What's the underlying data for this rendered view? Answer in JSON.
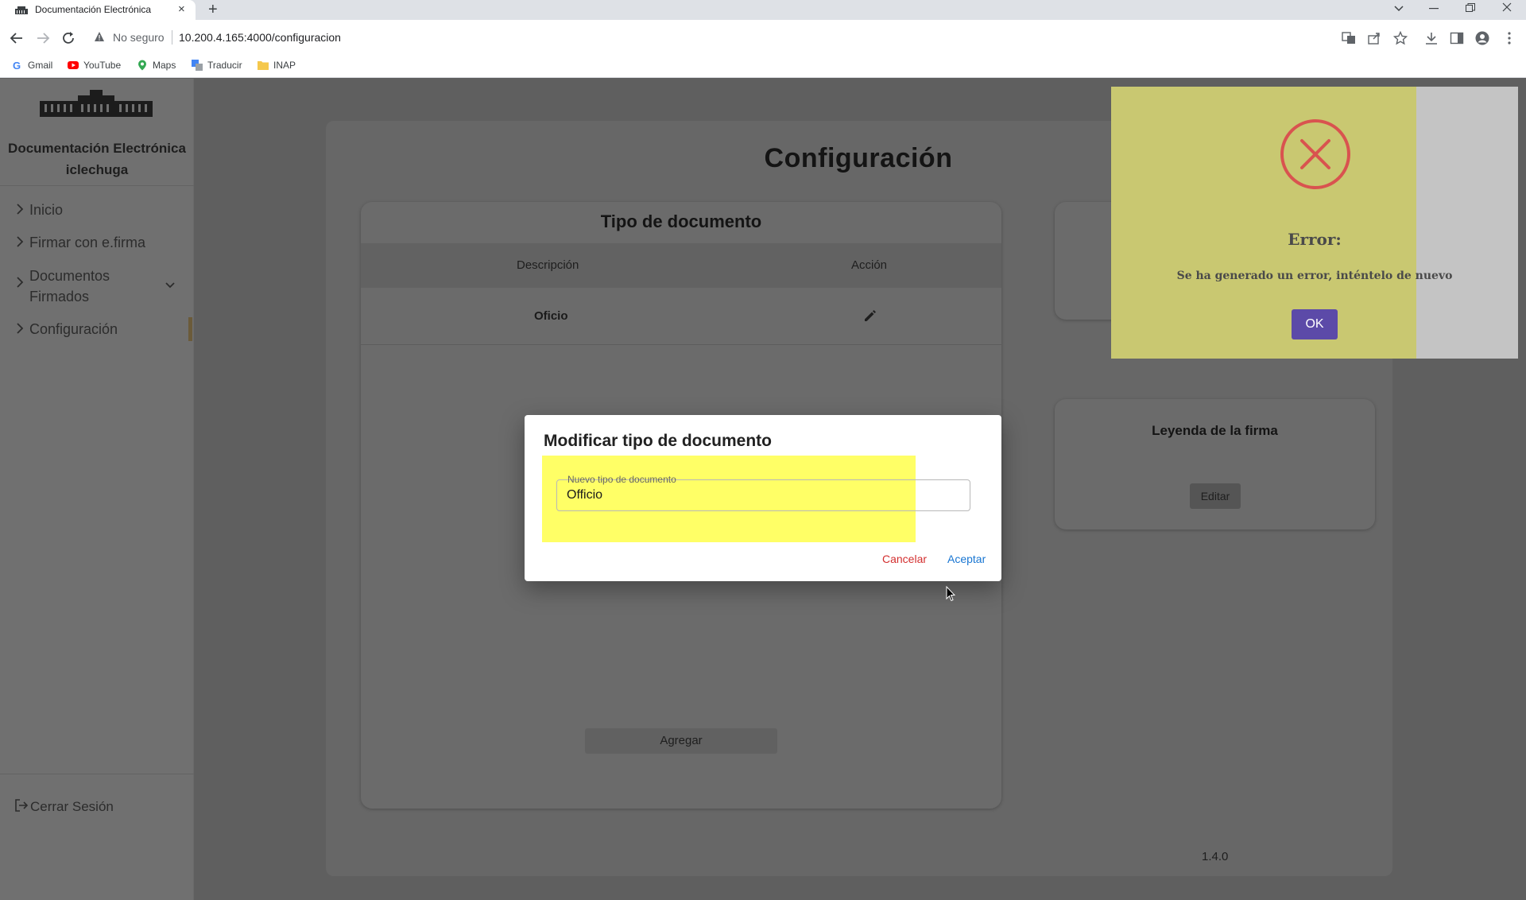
{
  "browser": {
    "tab_title": "Documentación Electrónica",
    "tab_close": "×",
    "new_tab": "+",
    "not_secure": "No seguro",
    "url": "10.200.4.165:4000/configuracion",
    "bookmarks": [
      "Gmail",
      "YouTube",
      "Maps",
      "Traducir",
      "INAP"
    ]
  },
  "sidebar": {
    "app_name": "Documentación Electrónica",
    "user": "iclechuga",
    "items": [
      {
        "label": "Inicio"
      },
      {
        "label": "Firmar con e.firma"
      },
      {
        "label": "Documentos Firmados"
      },
      {
        "label": "Configuración"
      }
    ],
    "logout": "Cerrar Sesión"
  },
  "main": {
    "title": "Configuración",
    "doc_card": {
      "title": "Tipo de documento",
      "columns": [
        "Descripción",
        "Acción"
      ],
      "rows": [
        {
          "descripcion": "Oficio"
        }
      ],
      "add_label": "Agregar"
    },
    "signature_card": {
      "title": "Leyenda de la firma",
      "edit_label": "Editar"
    },
    "version": "1.4.0"
  },
  "modal": {
    "title": "Modificar tipo de documento",
    "field_label": "Nuevo tipo de documento",
    "field_value": "Officio",
    "cancel_label": "Cancelar",
    "accept_label": "Aceptar"
  },
  "alert": {
    "title": "Error:",
    "message": "Se ha generado un error, inténtelo de nuevo",
    "ok_label": "OK"
  },
  "colors": {
    "alert_icon": "#d9534f",
    "ok_button": "#5c4aa8",
    "cancel": "#d32f2f",
    "accept": "#1976d2"
  }
}
